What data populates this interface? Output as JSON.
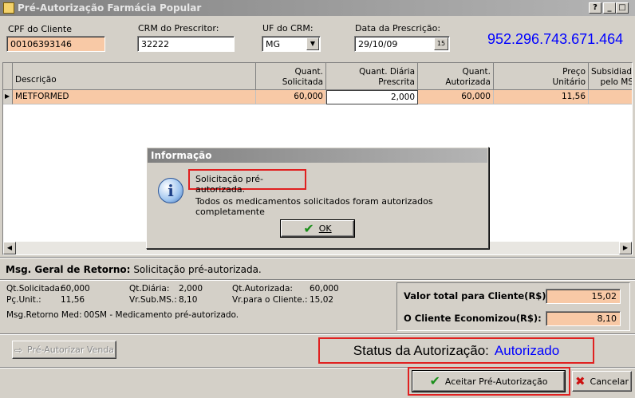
{
  "window": {
    "title": "Pré-Autorização Farmácia Popular",
    "controls": {
      "help": "?",
      "minimize": "_",
      "maximize": "□",
      "close": "✕"
    }
  },
  "form": {
    "cpf_label": "CPF do Cliente",
    "cpf_value": "00106393146",
    "crm_label": "CRM do Prescritor:",
    "crm_value": "32222",
    "uf_label": "UF do CRM:",
    "uf_value": "MG",
    "date_label": "Data da Prescrição:",
    "date_value": "29/10/09",
    "date_btn": "15",
    "authorization_number": "952.296.743.671.464"
  },
  "grid": {
    "headers": {
      "descricao": "Descrição",
      "quant_sol_1": "Quant.",
      "quant_sol_2": "Solicitada",
      "quant_dia_1": "Quant. Diária",
      "quant_dia_2": "Prescrita",
      "quant_aut_1": "Quant.",
      "quant_aut_2": "Autorizada",
      "preco_1": "Preço",
      "preco_2": "Unitário",
      "subs_1": "Subsidiado",
      "subs_2": "pelo MS"
    },
    "row": {
      "pointer": "▶",
      "descricao": "METFORMED",
      "quant_solicitada": "60,000",
      "quant_diaria": "2,000",
      "quant_autorizada": "60,000",
      "preco_unitario": "11,56",
      "subsidiado": ""
    }
  },
  "dialog": {
    "title": "Informação",
    "icon_glyph": "i",
    "line1": "Solicitação pré-autorizada.",
    "line2": "Todos os medicamentos solicitados foram autorizados completamente",
    "ok_label": "OK"
  },
  "summary": {
    "msg_label": "Msg. Geral de Retorno:",
    "msg_value": "Solicitação pré-autorizada.",
    "qt_sol_label": "Qt.Solicitada:",
    "qt_sol_value": "60,000",
    "pc_unit_label": "Pç.Unit.:",
    "pc_unit_value": "11,56",
    "qt_dia_label": "Qt.Diária:",
    "qt_dia_value": "2,000",
    "vr_sub_label": "Vr.Sub.MS.:",
    "vr_sub_value": "8,10",
    "qt_aut_label": "Qt.Autorizada:",
    "qt_aut_value": "60,000",
    "vr_cli_label": "Vr.para o Cliente.:",
    "vr_cli_value": "15,02",
    "msg_med_label": "Msg.Retorno Med:",
    "msg_med_value": "00SM - Medicamento pré-autorizado.",
    "total_cli_label": "Valor total para Cliente(R$):",
    "total_cli_value": "15,02",
    "economizou_label": "O Cliente Economizou(R$):",
    "economizou_value": "8,10"
  },
  "footer": {
    "pre_autorizar_label": "Pré-Autorizar Venda",
    "status_label": "Status da Autorização:",
    "status_value": "Autorizado",
    "aceitar_label": "Aceitar Pré-Autorização",
    "cancelar_label": "Cancelar"
  },
  "colors": {
    "status_value": "#0000ff",
    "highlight_box": "#e02020",
    "peach_field": "#f8c9a6"
  }
}
